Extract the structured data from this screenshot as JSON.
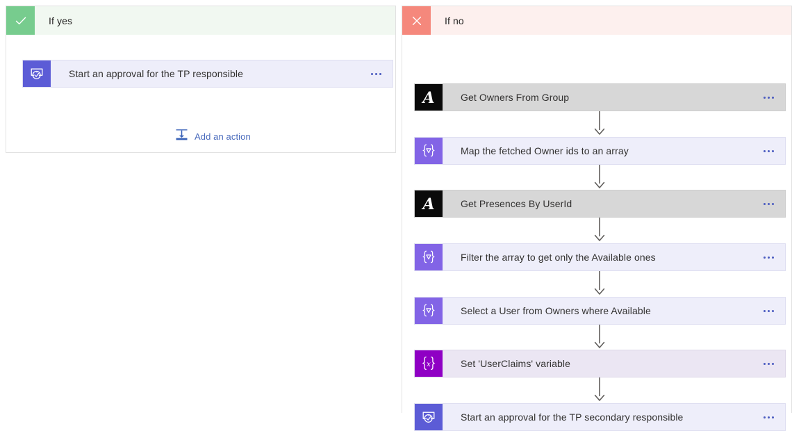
{
  "branches": [
    {
      "id": "if-yes",
      "title": "If yes",
      "badge_icon": "checkmark-icon",
      "badge_color": "#77cc8e",
      "header_bg": "#f1f8f1",
      "nodes": [
        {
          "label": "Start an approval for the TP responsible",
          "icon": "approval-icon",
          "icon_color": "#5c5cd6",
          "style": "lavender",
          "menu": "node-overflow-menu"
        }
      ],
      "add_action": {
        "label": "Add an action",
        "icon": "add-step-icon",
        "color": "#4a6bbd"
      }
    },
    {
      "id": "if-no",
      "title": "If no",
      "badge_icon": "close-icon",
      "badge_color": "#f5887c",
      "header_bg": "#fdf0ee",
      "nodes": [
        {
          "label": "Get Owners From Group",
          "icon": "custom-connector-a-icon",
          "icon_color": "#0a0a0a",
          "style": "gray",
          "menu": "node-overflow-menu"
        },
        {
          "label": "Map the fetched Owner ids to an array",
          "icon": "data-operation-icon",
          "icon_color": "#8264e6",
          "style": "lavender",
          "menu": "node-overflow-menu"
        },
        {
          "label": "Get Presences By UserId",
          "icon": "custom-connector-a-icon",
          "icon_color": "#0a0a0a",
          "style": "gray",
          "menu": "node-overflow-menu"
        },
        {
          "label": "Filter the array to get only the Available ones",
          "icon": "data-operation-icon",
          "icon_color": "#8264e6",
          "style": "lavender",
          "menu": "node-overflow-menu"
        },
        {
          "label": "Select a User from Owners where Available",
          "icon": "data-operation-icon",
          "icon_color": "#8264e6",
          "style": "lavender",
          "menu": "node-overflow-menu"
        },
        {
          "label": "Set 'UserClaims' variable",
          "icon": "variable-icon",
          "icon_color": "#8f00c4",
          "style": "lavender-dim",
          "menu": "node-overflow-menu"
        },
        {
          "label": "Start an approval for the TP secondary responsible",
          "icon": "approval-icon",
          "icon_color": "#5c5cd6",
          "style": "lavender",
          "menu": "node-overflow-menu"
        }
      ]
    }
  ],
  "colors": {
    "page_background": "#ffffff",
    "node_lavender": "#eeeefa",
    "node_gray": "#d7d7d7",
    "node_lavender_dim": "#ebe6f3",
    "connector_arrow": "#605e5c",
    "menu_dot": "#4a5bc0",
    "node_text": "#323130"
  }
}
